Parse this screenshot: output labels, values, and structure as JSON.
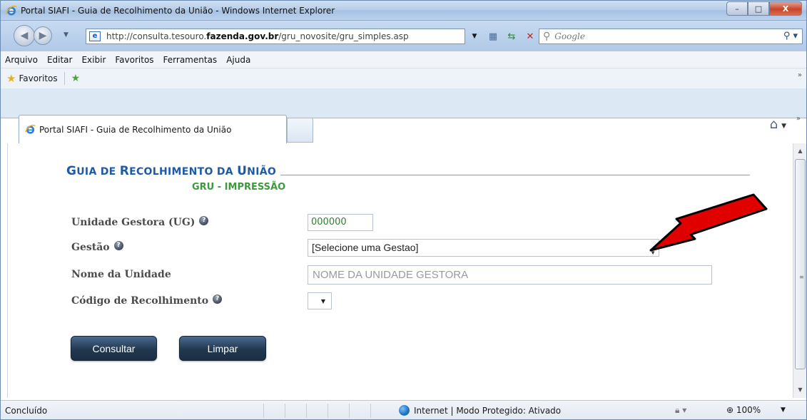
{
  "window": {
    "title": "Portal SIAFI - Guia de Recolhimento da União - Windows Internet Explorer",
    "controls": {
      "minimize": "–",
      "maximize": "□",
      "close": "X"
    }
  },
  "nav": {
    "url_prefix": "http://consulta.tesouro.",
    "url_bold": "fazenda.gov.br",
    "url_suffix": "/gru_novosite/gru_simples.asp",
    "search_placeholder": "Google"
  },
  "menu": {
    "items": [
      "Arquivo",
      "Editar",
      "Exibir",
      "Favoritos",
      "Ferramentas",
      "Ajuda"
    ]
  },
  "favorites": {
    "label": "Favoritos"
  },
  "tabs": [
    {
      "label": "Portal SIAFI - Guia de Recolhimento da União",
      "active": true
    }
  ],
  "page": {
    "heading_parts": [
      "G",
      "UIA DE ",
      "R",
      "ECOLHIMENTO DA ",
      "U",
      "NIÃO"
    ],
    "subheading": "GRU - IMPRESSÃO",
    "fields": {
      "ug_label": "Unidade Gestora (UG)",
      "ug_value": "000000",
      "gestao_label": "Gestão",
      "gestao_value": "[Selecione uma Gestao]",
      "nome_label": "Nome da Unidade",
      "nome_value": "NOME DA UNIDADE GESTORA",
      "codigo_label": "Código de Recolhimento"
    },
    "buttons": {
      "consultar": "Consultar",
      "limpar": "Limpar"
    }
  },
  "status": {
    "text": "Concluído",
    "zone": "Internet | Modo Protegido: Ativado",
    "zoom": "100%"
  },
  "colors": {
    "heading": "#1f5aa6",
    "subheading": "#3c9a3c",
    "arrow": "#e00000",
    "button": "#21384f"
  }
}
